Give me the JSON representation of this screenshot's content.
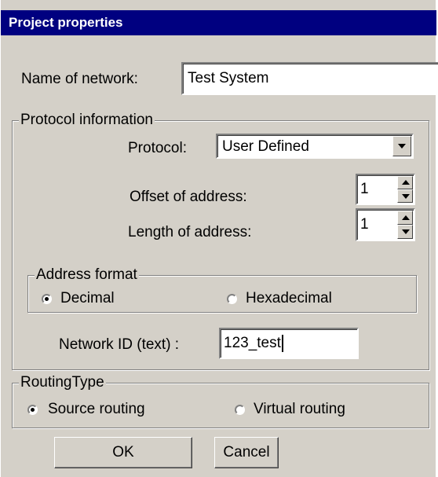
{
  "window": {
    "title": "Project properties"
  },
  "network_name": {
    "label": "Name of network:",
    "value": "Test System"
  },
  "protocol_info": {
    "legend": "Protocol information",
    "protocol_label": "Protocol:",
    "protocol_value": "User Defined",
    "offset_label": "Offset of address:",
    "offset_value": "1",
    "length_label": "Length of address:",
    "length_value": "1",
    "address_format": {
      "legend": "Address format",
      "options": [
        {
          "label": "Decimal",
          "selected": true
        },
        {
          "label": "Hexadecimal",
          "selected": false
        }
      ]
    },
    "network_id_label": "Network ID (text) :",
    "network_id_value": "123_test"
  },
  "routing": {
    "legend": "RoutingType",
    "options": [
      {
        "label": "Source routing",
        "selected": true
      },
      {
        "label": "Virtual routing",
        "selected": false
      }
    ]
  },
  "buttons": {
    "ok": "OK",
    "cancel": "Cancel"
  }
}
